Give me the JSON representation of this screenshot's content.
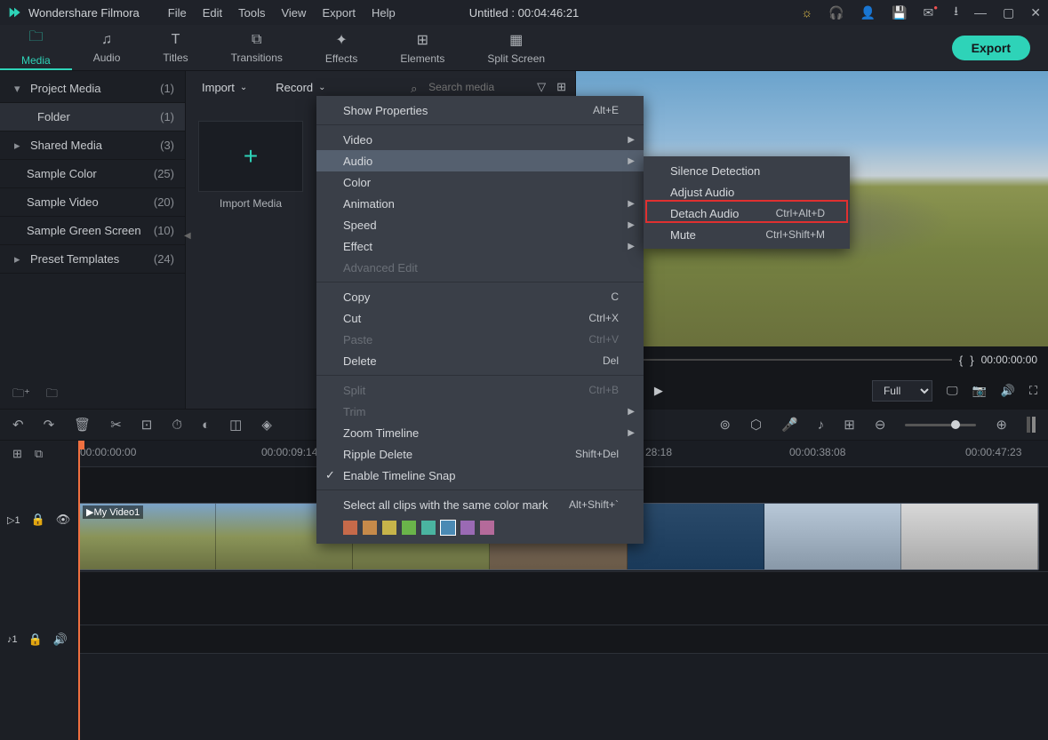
{
  "app": {
    "name": "Wondershare Filmora",
    "doc_title": "Untitled : 00:04:46:21"
  },
  "menu": {
    "file": "File",
    "edit": "Edit",
    "tools": "Tools",
    "view": "View",
    "export": "Export",
    "help": "Help"
  },
  "tabs": {
    "media": "Media",
    "audio": "Audio",
    "titles": "Titles",
    "transitions": "Transitions",
    "effects": "Effects",
    "elements": "Elements",
    "split_screen": "Split Screen",
    "export_btn": "Export"
  },
  "import_bar": {
    "import": "Import",
    "record": "Record",
    "search_placeholder": "Search media"
  },
  "media_tree": [
    {
      "label": "Project Media",
      "count": "(1)",
      "arrow": "▾"
    },
    {
      "label": "Folder",
      "count": "(1)",
      "arrow": "",
      "active": true
    },
    {
      "label": "Shared Media",
      "count": "(3)",
      "arrow": "▸"
    },
    {
      "label": "Sample Color",
      "count": "(25)",
      "arrow": ""
    },
    {
      "label": "Sample Video",
      "count": "(20)",
      "arrow": ""
    },
    {
      "label": "Sample Green Screen",
      "count": "(10)",
      "arrow": ""
    },
    {
      "label": "Preset Templates",
      "count": "(24)",
      "arrow": "▸"
    }
  ],
  "import_tile": {
    "label": "Import Media"
  },
  "preview": {
    "time_brackets_l": "{",
    "time_brackets_r": "}",
    "timecode": "00:00:00:00",
    "quality": "Full"
  },
  "ruler": {
    "t0": "00:00:00:00",
    "t1": "00:00:09:14",
    "t2": "28:18",
    "t3": "00:00:38:08",
    "t4": "00:00:47:23"
  },
  "clip": {
    "name": "My Video1"
  },
  "track_labels": {
    "video": "1",
    "audio": "1"
  },
  "ctx": {
    "show_properties": "Show Properties",
    "show_properties_key": "Alt+E",
    "video": "Video",
    "audio": "Audio",
    "color": "Color",
    "animation": "Animation",
    "speed": "Speed",
    "effect": "Effect",
    "advanced": "Advanced Edit",
    "copy": "Copy",
    "copy_key": "C",
    "cut": "Cut",
    "cut_key": "Ctrl+X",
    "paste": "Paste",
    "paste_key": "Ctrl+V",
    "delete": "Delete",
    "delete_key": "Del",
    "split": "Split",
    "split_key": "Ctrl+B",
    "trim": "Trim",
    "zoom": "Zoom Timeline",
    "ripple": "Ripple Delete",
    "ripple_key": "Shift+Del",
    "snap": "Enable Timeline Snap",
    "select_color": "Select all clips with the same color mark",
    "select_color_key": "Alt+Shift+`",
    "colors": [
      "#c66a4a",
      "#c68a4a",
      "#c6b44a",
      "#6ab44a",
      "#4ab4a0",
      "#4a8ab4",
      "#6a6ab4",
      "#9a6ab4",
      "#b46a9a"
    ]
  },
  "ctx_sub": {
    "silence": "Silence Detection",
    "adjust": "Adjust Audio",
    "detach": "Detach Audio",
    "detach_key": "Ctrl+Alt+D",
    "mute": "Mute",
    "mute_key": "Ctrl+Shift+M"
  }
}
